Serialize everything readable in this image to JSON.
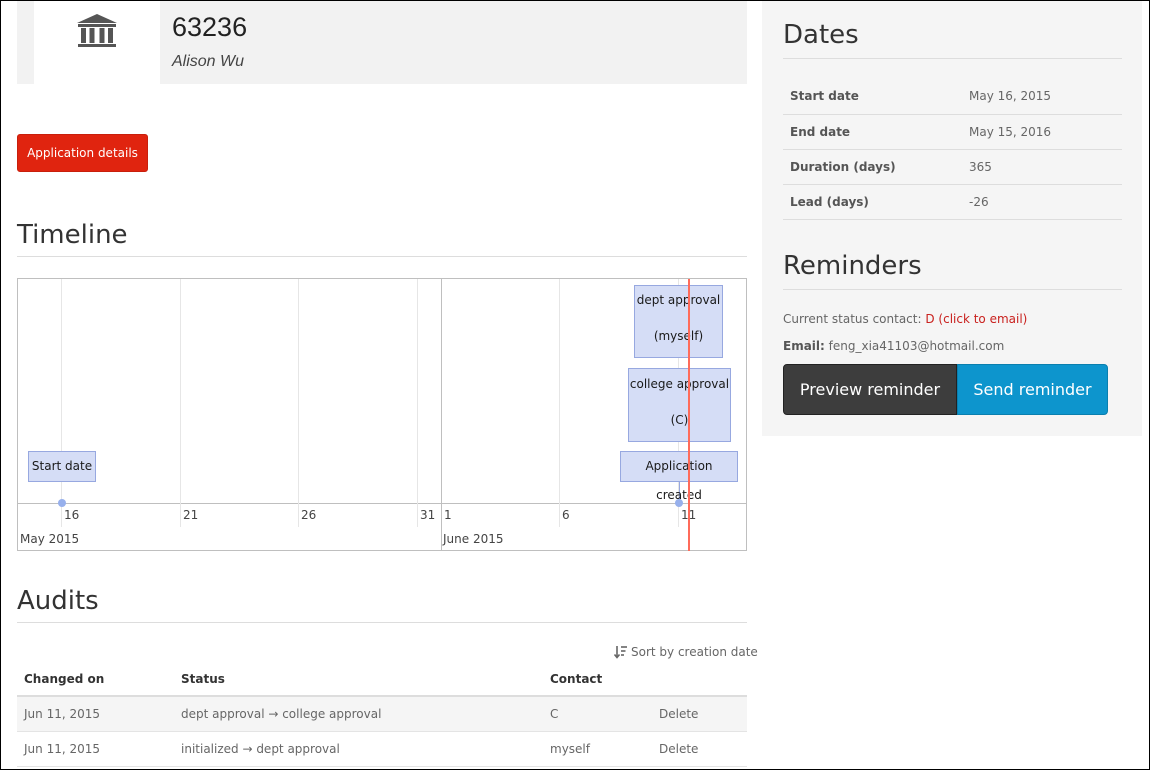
{
  "header": {
    "number": "63236",
    "name": "Alison Wu",
    "icon": "institution-icon"
  },
  "buttons": {
    "application_details": "Application details",
    "preview_reminder": "Preview reminder",
    "send_reminder": "Send reminder"
  },
  "timeline": {
    "title": "Timeline",
    "months": [
      "May 2015",
      "June 2015"
    ],
    "day_labels": [
      "16",
      "21",
      "26",
      "31",
      "1",
      "6",
      "11"
    ],
    "items": [
      {
        "line1": "Start date",
        "line2": ""
      },
      {
        "line1": "dept approval",
        "line2": "(myself)"
      },
      {
        "line1": "college approval",
        "line2": "(C)"
      },
      {
        "line1": "Application created",
        "line2": ""
      }
    ]
  },
  "audits": {
    "title": "Audits",
    "sort_label": "Sort by creation date",
    "columns": [
      "Changed on",
      "Status",
      "Contact",
      ""
    ],
    "rows": [
      {
        "changed_on": "Jun 11, 2015",
        "status": "dept approval → college approval",
        "contact": "C",
        "action": "Delete"
      },
      {
        "changed_on": "Jun 11, 2015",
        "status": "initialized → dept approval",
        "contact": "myself",
        "action": "Delete"
      }
    ]
  },
  "dates": {
    "title": "Dates",
    "rows": [
      {
        "label": "Start date",
        "value": "May 16, 2015"
      },
      {
        "label": "End date",
        "value": "May 15, 2016"
      },
      {
        "label": "Duration (days)",
        "value": "365"
      },
      {
        "label": "Lead (days)",
        "value": "-26"
      }
    ]
  },
  "reminders": {
    "title": "Reminders",
    "contact_label": "Current status contact:",
    "contact_link": "D (click to email)",
    "email_label": "Email:",
    "email_value": "feng_xia41103@hotmail.com"
  },
  "colors": {
    "accent_red": "#e0240f",
    "send_blue": "#0d95cd",
    "preview_dark": "#3d3d3d",
    "timeline_item_bg": "#d5ddf6",
    "now_marker": "#ff6b5a"
  }
}
